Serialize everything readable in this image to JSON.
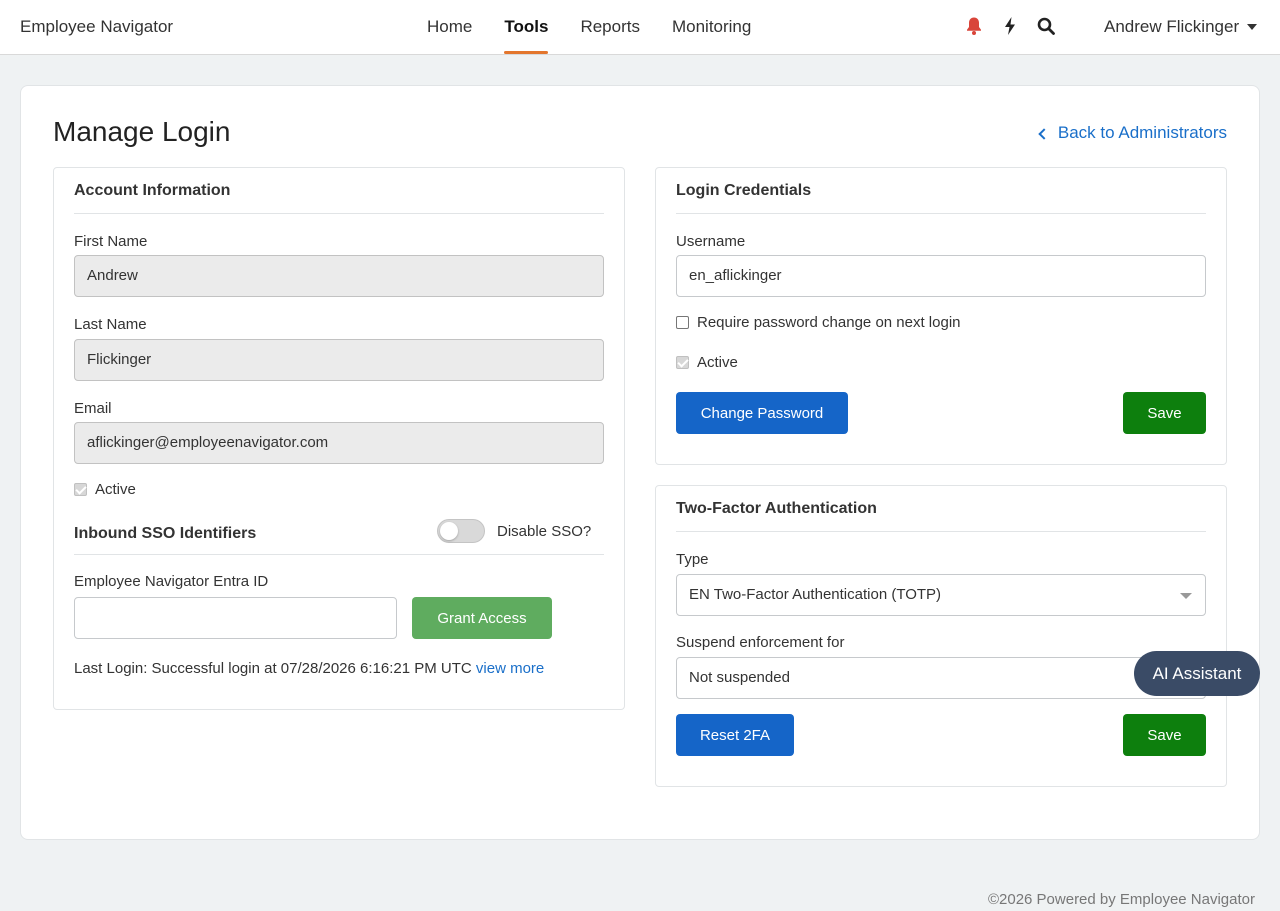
{
  "app": {
    "brand": "Employee Navigator"
  },
  "nav": {
    "home": "Home",
    "tools": "Tools",
    "reports": "Reports",
    "monitoring": "Monitoring"
  },
  "header_icons": [
    "bell-icon",
    "bolt-icon",
    "search-icon"
  ],
  "user": {
    "name": "Andrew Flickinger"
  },
  "page": {
    "title": "Manage Login",
    "back_link": "Back to Administrators"
  },
  "account": {
    "title": "Account Information",
    "first_name_label": "First Name",
    "first_name": "Andrew",
    "last_name_label": "Last Name",
    "last_name": "Flickinger",
    "email_label": "Email",
    "email": "aflickinger@employeenavigator.com",
    "active_label": "Active",
    "active_checked": true,
    "sso_title": "Inbound SSO Identifiers",
    "disable_sso_label": "Disable SSO?",
    "disable_sso_on": false,
    "entra_label": "Employee Navigator Entra ID",
    "entra_value": "",
    "grant_access": "Grant Access",
    "last_login": "Last Login: Successful login at 07/28/2026 6:16:21 PM UTC",
    "view_more": "view more"
  },
  "credentials": {
    "title": "Login Credentials",
    "username_label": "Username",
    "username": "en_aflickinger",
    "require_change_label": "Require password change on next login",
    "require_change_checked": false,
    "active_label": "Active",
    "active_checked": true,
    "change_password": "Change Password",
    "save": "Save"
  },
  "two_factor": {
    "title": "Two-Factor Authentication",
    "type_label": "Type",
    "type_value": "EN Two-Factor Authentication (TOTP)",
    "suspend_label": "Suspend enforcement for",
    "suspend_value": "Not suspended",
    "reset": "Reset 2FA",
    "save": "Save"
  },
  "ai_assistant": "AI Assistant",
  "footer": "©2026 Powered by Employee Navigator",
  "colors": {
    "primary_blue": "#1565c8",
    "save_green": "#0d7f0d",
    "grant_green": "#5fac5f",
    "nav_accent": "#e3762d",
    "bell_red": "#d9453a",
    "link": "#1a6fc9"
  }
}
